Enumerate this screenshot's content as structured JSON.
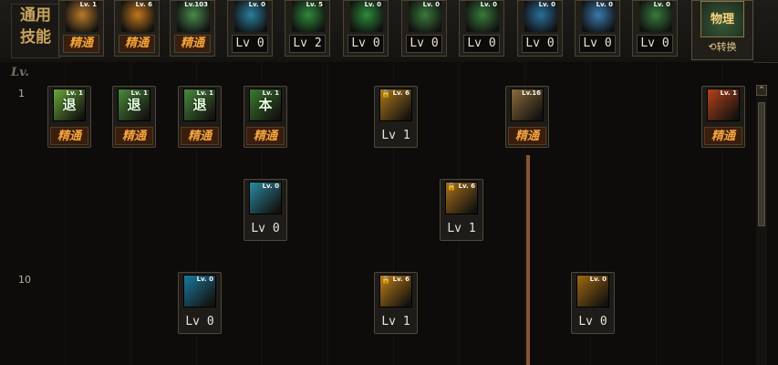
{
  "common_skills": {
    "label_line1": "通用",
    "label_line2": "技能",
    "slots": [
      {
        "level_text": "精通",
        "mini_lv": "Lv. 1",
        "icon": "figure-sitting-icon",
        "color": "#b97a2a"
      },
      {
        "level_text": "精通",
        "mini_lv": "Lv. 6",
        "icon": "flame-figure-icon",
        "color": "#c0761c"
      },
      {
        "level_text": "精通",
        "mini_lv": "Lv.103",
        "icon": "leap-figure-icon",
        "color": "#4a8a4c"
      },
      {
        "level_text": "Lv 0",
        "mini_lv": "Lv. 0",
        "icon": "wing-icon",
        "color": "#2b7fa0"
      },
      {
        "level_text": "Lv 2",
        "mini_lv": "Lv. 5",
        "icon": "crosshair-icon",
        "color": "#2e8a3a"
      },
      {
        "level_text": "Lv 0",
        "mini_lv": "Lv. 0",
        "icon": "crosshair-icon",
        "color": "#2e8a3a"
      },
      {
        "level_text": "Lv 0",
        "mini_lv": "Lv. 0",
        "icon": "figure-icon",
        "color": "#3a7a3c"
      },
      {
        "level_text": "Lv 0",
        "mini_lv": "Lv. 0",
        "icon": "figure-icon",
        "color": "#3a7a3c"
      },
      {
        "level_text": "Lv 0",
        "mini_lv": "Lv. 0",
        "icon": "eye-icon",
        "color": "#2a6f9a"
      },
      {
        "level_text": "Lv 0",
        "mini_lv": "Lv. 0",
        "icon": "figure-blue-icon",
        "color": "#3a7ab0"
      },
      {
        "level_text": "Lv 0",
        "mini_lv": "Lv. 0",
        "icon": "figure-icon",
        "color": "#3a7a3c"
      }
    ]
  },
  "switch": {
    "icon_text": "物理",
    "button_label": "⟲转换"
  },
  "tree": {
    "lv_header": "Lv.",
    "rows": [
      {
        "label": "1"
      },
      {
        "label": "10"
      }
    ],
    "skills": [
      {
        "name": "skill-retreat-1",
        "level_text": "精通",
        "mini_lv": "Lv. 1",
        "glyph": "退",
        "color": "#6aa83a",
        "locked": false
      },
      {
        "name": "skill-retreat-2",
        "level_text": "精通",
        "mini_lv": "Lv. 1",
        "glyph": "退",
        "color": "#4a8a3c",
        "locked": false
      },
      {
        "name": "skill-retreat-3",
        "level_text": "精通",
        "mini_lv": "Lv. 1",
        "glyph": "退",
        "color": "#4a8a3c",
        "locked": false
      },
      {
        "name": "skill-stance",
        "level_text": "精通",
        "mini_lv": "Lv. 1",
        "glyph": "本",
        "color": "#3c7a30",
        "locked": false
      },
      {
        "name": "skill-dash-strike",
        "level_text": "Lv 1",
        "mini_lv": "Lv. 6",
        "glyph": "",
        "color": "#b07a1a",
        "locked": true
      },
      {
        "name": "skill-slash-wave",
        "level_text": "精通",
        "mini_lv": "Lv.16",
        "glyph": "",
        "color": "#8a6a3a",
        "locked": false
      },
      {
        "name": "skill-flame-burst",
        "level_text": "精通",
        "mini_lv": "Lv. 1",
        "glyph": "",
        "color": "#b5421a",
        "locked": false
      },
      {
        "name": "skill-palm-blast",
        "level_text": "Lv 0",
        "mini_lv": "Lv. 0",
        "glyph": "",
        "color": "#2a8aa0",
        "locked": false
      },
      {
        "name": "skill-bullet-strike",
        "level_text": "Lv 1",
        "mini_lv": "Lv. 6",
        "glyph": "",
        "color": "#a8701a",
        "locked": true
      },
      {
        "name": "skill-anchor",
        "level_text": "Lv 0",
        "mini_lv": "Lv. 0",
        "glyph": "",
        "color": "#1a7aa0",
        "locked": false
      },
      {
        "name": "skill-fist-strike",
        "level_text": "Lv 1",
        "mini_lv": "Lv. 6",
        "glyph": "",
        "color": "#c08018",
        "locked": true
      },
      {
        "name": "skill-claw-sweep",
        "level_text": "Lv 0",
        "mini_lv": "Lv. 0",
        "glyph": "",
        "color": "#a06a12",
        "locked": false
      }
    ]
  }
}
